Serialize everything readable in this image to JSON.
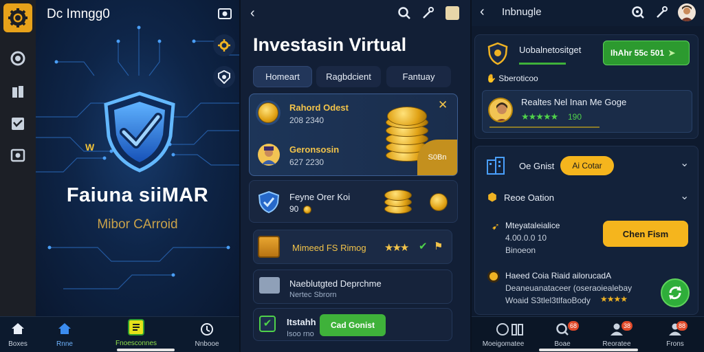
{
  "panel1": {
    "title": "Dc Imngg0",
    "brand": "Faiuna siiMAR",
    "subtitle": "Mibor CArroid",
    "nav": [
      {
        "label": "Boxes",
        "icon": "home-icon"
      },
      {
        "label": "Rnne",
        "icon": "house-icon"
      },
      {
        "label": "Fnoesconnes",
        "icon": "note-icon"
      },
      {
        "label": "Nnbooe",
        "icon": "settings-circle-icon"
      }
    ],
    "side_mark": "W"
  },
  "panel2": {
    "heading": "Investasin Virtual",
    "tabs": [
      "Homeart",
      "Ragbdcient",
      "Fantuay"
    ],
    "card1": {
      "row1_title": "Rahord Odest",
      "row1_value": "208 2340",
      "row2_title": "Geronsosin",
      "row2_value": "627 2230",
      "badge": "S0Bn"
    },
    "card2": {
      "title": "Feyne Orer Koi",
      "value": "90"
    },
    "card3": {
      "title": "Mimeed FS Rimog"
    },
    "card4": {
      "title": "Naeblutgted Deprchme",
      "subtitle": "Nertec Sbrorn"
    },
    "card5": {
      "title": "Itstahh",
      "subtitle": "Isoo rno",
      "button": "Cad Gonist"
    }
  },
  "panel3": {
    "title": "Inbnugle",
    "top_card": {
      "title": "Uobalnetositget",
      "button": "IhAhr 55c 501",
      "section": "Sberoticoo",
      "profile_title": "Realtes Nel Inan Me Goge",
      "rating_value": "190"
    },
    "list": {
      "item1_label": "Oe Gnist",
      "item1_chip": "Ai Cotar",
      "item2_label": "Reoe Oation",
      "item3_title": "Mteyataleialice",
      "item3_value": "4.00.0.0 10",
      "item3_sub": "Binoeon",
      "item3_button": "Chen Fism",
      "item4_title": "Haeed Coia Riaid ailorucadA",
      "item4_line2": "Deaneuanataceer (oseraoiealebay",
      "item4_line3": "Woaid  S3tlel3tlfaoBody"
    },
    "nav": [
      {
        "label": "Moeigomatee",
        "badge": ""
      },
      {
        "label": "Boae",
        "badge": "68"
      },
      {
        "label": "Reoratee",
        "badge": "38"
      },
      {
        "label": "Frons",
        "badge": "88"
      }
    ]
  },
  "colors": {
    "accent": "#f5b51d",
    "green": "#2fae3a",
    "background": "#0b1626",
    "card": "#18263f"
  }
}
